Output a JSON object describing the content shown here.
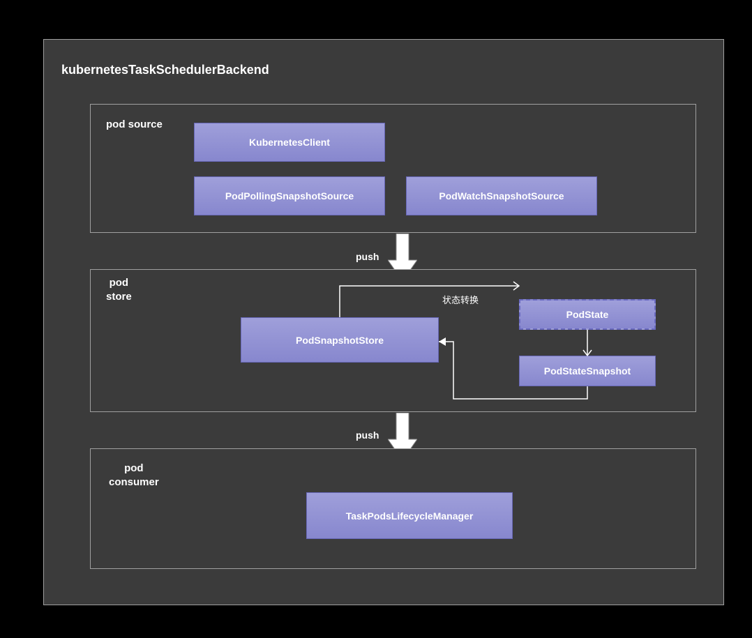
{
  "title": "kubernetesTaskSchedulerBackend",
  "sections": {
    "source": {
      "label": "pod source"
    },
    "store": {
      "label": "pod\nstore"
    },
    "consumer": {
      "label": "pod\nconsumer"
    }
  },
  "boxes": {
    "kubeClient": "KubernetesClient",
    "pollingSource": "PodPollingSnapshotSource",
    "watchSource": "PodWatchSnapshotSource",
    "snapshotStore": "PodSnapshotStore",
    "podState": "PodState",
    "podStateSnapshot": "PodStateSnapshot",
    "lifecycleManager": "TaskPodsLifecycleManager"
  },
  "arrows": {
    "push1": "push",
    "push2": "push"
  },
  "labels": {
    "stateTransition": "状态转换"
  }
}
